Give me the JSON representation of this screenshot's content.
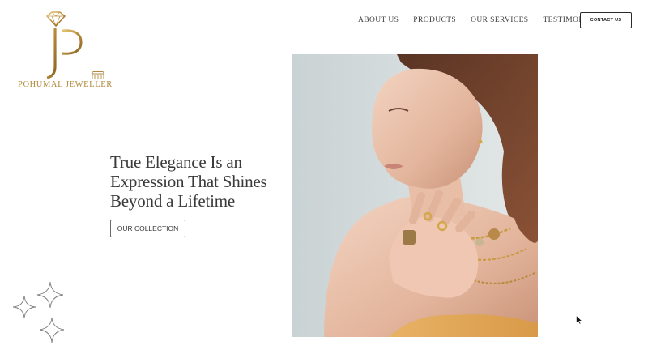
{
  "logo": {
    "brand_name": "POHUMAL JEWELLER",
    "mark_icon": "diamond-pj-monogram-icon",
    "shop_icon": "storefront-icon",
    "gold_color": "#b08a3e"
  },
  "nav": {
    "items": [
      {
        "label": "ABOUT US"
      },
      {
        "label": "PRODUCTS"
      },
      {
        "label": "OUR SERVICES"
      },
      {
        "label": "TESTIMONIALS"
      }
    ],
    "contact_label": "CONTACT US"
  },
  "hero": {
    "title_lines": [
      "True Elegance Is an",
      "Expression That Shines",
      "Beyond a Lifetime"
    ],
    "cta_label": "OUR COLLECTION",
    "image_icon": "model-wearing-gold-jewellery-photo"
  },
  "decor": {
    "sparkle_icon": "four-point-star-icon"
  }
}
